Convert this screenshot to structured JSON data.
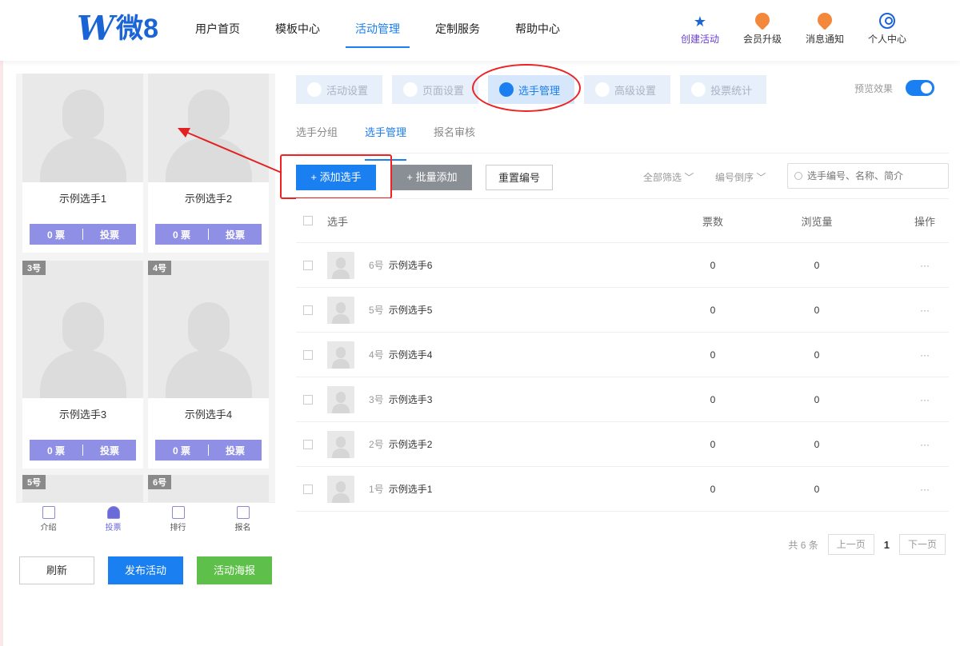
{
  "logo": {
    "letter": "W",
    "text": "微8"
  },
  "nav": [
    {
      "label": "用户首页",
      "active": false
    },
    {
      "label": "模板中心",
      "active": false
    },
    {
      "label": "活动管理",
      "active": true
    },
    {
      "label": "定制服务",
      "active": false
    },
    {
      "label": "帮助中心",
      "active": false
    }
  ],
  "header_actions": {
    "create": "创建活动",
    "upgrade": "会员升级",
    "notify": "消息通知",
    "profile": "个人中心"
  },
  "preview_cards": [
    {
      "num": "",
      "name": "示例选手1",
      "votes": "0 票",
      "vote_btn": "投票"
    },
    {
      "num": "",
      "name": "示例选手2",
      "votes": "0 票",
      "vote_btn": "投票"
    },
    {
      "num": "3号",
      "name": "示例选手3",
      "votes": "0 票",
      "vote_btn": "投票"
    },
    {
      "num": "4号",
      "name": "示例选手4",
      "votes": "0 票",
      "vote_btn": "投票"
    },
    {
      "num": "5号",
      "name": "",
      "votes": "",
      "vote_btn": ""
    },
    {
      "num": "6号",
      "name": "",
      "votes": "",
      "vote_btn": ""
    }
  ],
  "preview_tabbar": [
    {
      "label": "介绍",
      "icon": "intro-icon"
    },
    {
      "label": "投票",
      "icon": "vote-icon",
      "active": true
    },
    {
      "label": "排行",
      "icon": "rank-icon"
    },
    {
      "label": "报名",
      "icon": "signup-icon"
    }
  ],
  "left_buttons": {
    "refresh": "刷新",
    "publish": "发布活动",
    "poster": "活动海报"
  },
  "steps": [
    {
      "label": "活动设置"
    },
    {
      "label": "页面设置"
    },
    {
      "label": "选手管理",
      "active": true
    },
    {
      "label": "高级设置"
    },
    {
      "label": "投票统计"
    }
  ],
  "preview_label": "预览效果",
  "subtabs": [
    {
      "label": "选手分组"
    },
    {
      "label": "选手管理",
      "active": true
    },
    {
      "label": "报名审核"
    }
  ],
  "toolbar": {
    "add": "+ 添加选手",
    "batch": "+ 批量添加",
    "renumber": "重置编号",
    "filter_all": "全部筛选 ﹀",
    "sort": "编号倒序 ﹀",
    "search_placeholder": "选手编号、名称、简介"
  },
  "table": {
    "headers": {
      "player": "选手",
      "votes": "票数",
      "views": "浏览量",
      "ops": "操作"
    },
    "rows": [
      {
        "num": "6号",
        "name": "示例选手6",
        "votes": "0",
        "views": "0",
        "ops": "···"
      },
      {
        "num": "5号",
        "name": "示例选手5",
        "votes": "0",
        "views": "0",
        "ops": "···"
      },
      {
        "num": "4号",
        "name": "示例选手4",
        "votes": "0",
        "views": "0",
        "ops": "···"
      },
      {
        "num": "3号",
        "name": "示例选手3",
        "votes": "0",
        "views": "0",
        "ops": "···"
      },
      {
        "num": "2号",
        "name": "示例选手2",
        "votes": "0",
        "views": "0",
        "ops": "···"
      },
      {
        "num": "1号",
        "name": "示例选手1",
        "votes": "0",
        "views": "0",
        "ops": "···"
      }
    ]
  },
  "pager": {
    "total": "共 6 条",
    "prev": "上一页",
    "current": "1",
    "next": "下一页"
  },
  "colors": {
    "accent": "#1a7ff0",
    "vote_bar": "#8f8fe6",
    "annotation": "#e22222",
    "poster_green": "#5ec04a"
  }
}
